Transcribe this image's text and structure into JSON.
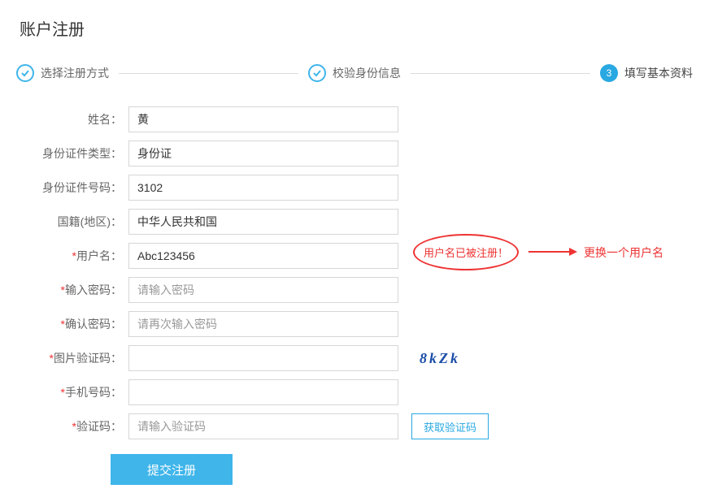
{
  "title": "账户注册",
  "steps": {
    "s1": {
      "label": "选择注册方式"
    },
    "s2": {
      "label": "校验身份信息"
    },
    "s3": {
      "num": "3",
      "label": "填写基本资料"
    }
  },
  "fields": {
    "name": {
      "label": "姓名",
      "value": "黄"
    },
    "idtype": {
      "label": "身份证件类型",
      "value": "身份证"
    },
    "idno": {
      "label": "身份证件号码",
      "value": "3102"
    },
    "nation": {
      "label": "国籍(地区)",
      "value": "中华人民共和国"
    },
    "username": {
      "label": "用户名",
      "value": "Abc123456"
    },
    "password": {
      "label": "输入密码",
      "placeholder": "请输入密码"
    },
    "confirm": {
      "label": "确认密码",
      "placeholder": "请再次输入密码"
    },
    "captcha": {
      "label": "图片验证码",
      "image_text": "8kZk"
    },
    "phone": {
      "label": "手机号码"
    },
    "smscode": {
      "label": "验证码",
      "placeholder": "请输入验证码"
    }
  },
  "buttons": {
    "get_verify": "获取验证码",
    "submit": "提交注册"
  },
  "annotation": {
    "error": "用户名已被注册！",
    "tip": "更换一个用户名"
  },
  "colon": "："
}
